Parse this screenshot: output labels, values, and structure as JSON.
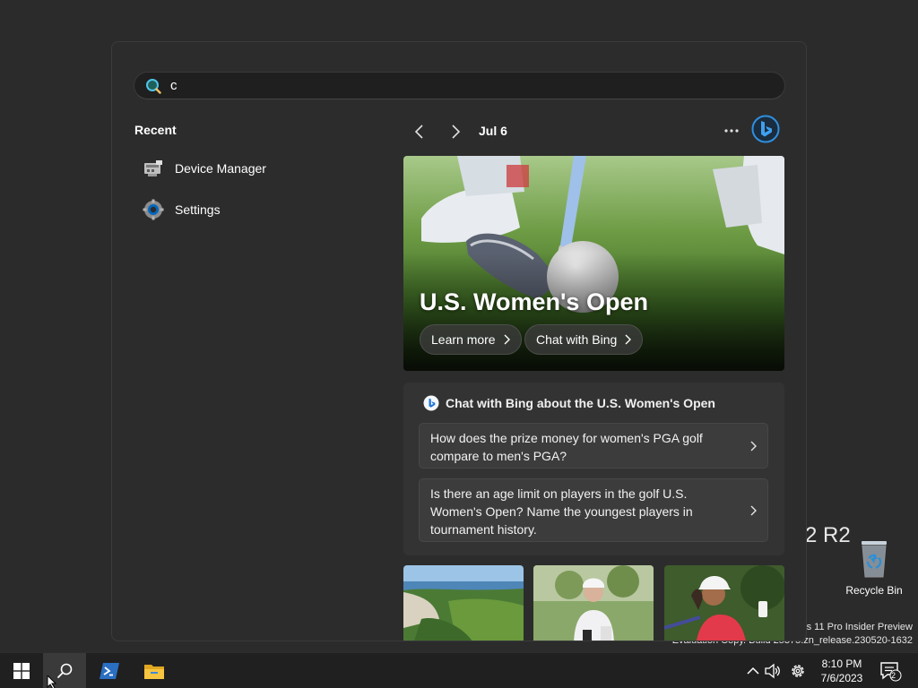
{
  "desktop": {
    "edition_fragment": "2 R2",
    "eval_line1": "s 11 Pro Insider Preview",
    "eval_line2": "Evaluation Copy. Build 25375.zn_release.230520-1632",
    "recycle_bin_label": "Recycle Bin"
  },
  "search": {
    "query": "c",
    "icon": "search-icon"
  },
  "recent": {
    "title": "Recent",
    "items": [
      {
        "label": "Device Manager",
        "icon": "device-manager-icon"
      },
      {
        "label": "Settings",
        "icon": "settings-gear-icon"
      }
    ]
  },
  "bing": {
    "date": "Jul 6",
    "hero": {
      "title": "U.S. Women's Open",
      "learn_more": "Learn more",
      "chat_with_bing": "Chat with Bing"
    },
    "chat": {
      "heading": "Chat with Bing about the U.S. Women's Open",
      "questions": [
        "How does the prize money for women's PGA golf compare to men's PGA?",
        "Is there an age limit on players in the golf U.S. Women's Open? Name the youngest players in tournament history."
      ]
    }
  },
  "taskbar": {
    "time": "8:10 PM",
    "date": "7/6/2023",
    "notification_count": "2"
  },
  "colors": {
    "accent": "#0078d4",
    "panel_bg": "#2c2c2c",
    "card_bg": "#333333",
    "taskbar_bg": "#202020"
  }
}
